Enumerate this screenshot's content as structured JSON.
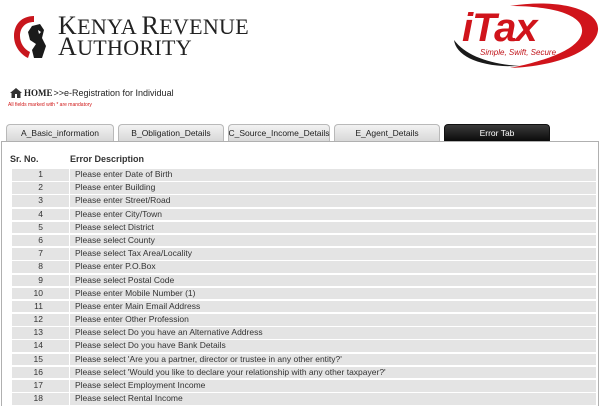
{
  "header": {
    "org_line1_big": "K",
    "org_line1_rest": "ENYA ",
    "org_line1_big2": "R",
    "org_line1_rest2": "EVENUE",
    "org_line2_big": "A",
    "org_line2_rest": "UTHORITY",
    "itax_word": "iTax",
    "itax_tagline": "Simple, Swift, Secure"
  },
  "breadcrumb": {
    "home": "HOME",
    "path": ">>e-Registration for Individual"
  },
  "mandatory_note": "All fields marked with * are mandatory",
  "tabs": [
    {
      "label": "A_Basic_information"
    },
    {
      "label": "B_Obligation_Details"
    },
    {
      "label": "C_Source_Income_Details"
    },
    {
      "label": "E_Agent_Details"
    },
    {
      "label": "Error Tab"
    }
  ],
  "table": {
    "col_sr": "Sr. No.",
    "col_desc": "Error Description",
    "rows": [
      {
        "no": "1",
        "desc": "Please enter Date of Birth"
      },
      {
        "no": "2",
        "desc": "Please enter Building"
      },
      {
        "no": "3",
        "desc": "Please enter Street/Road"
      },
      {
        "no": "4",
        "desc": "Please enter City/Town"
      },
      {
        "no": "5",
        "desc": "Please select District"
      },
      {
        "no": "6",
        "desc": "Please select County"
      },
      {
        "no": "7",
        "desc": "Please select Tax Area/Locality"
      },
      {
        "no": "8",
        "desc": "Please enter P.O.Box"
      },
      {
        "no": "9",
        "desc": "Please select Postal Code"
      },
      {
        "no": "10",
        "desc": "Please enter Mobile Number (1)"
      },
      {
        "no": "11",
        "desc": "Please enter Main Email Address"
      },
      {
        "no": "12",
        "desc": "Please enter Other Profession"
      },
      {
        "no": "13",
        "desc": "Please select Do you have an Alternative Address"
      },
      {
        "no": "14",
        "desc": "Please select Do you have Bank Details"
      },
      {
        "no": "15",
        "desc": "Please select 'Are you a partner, director or trustee in any other entity?'"
      },
      {
        "no": "16",
        "desc": "Please select 'Would you like to declare your relationship with any other taxpayer?'"
      },
      {
        "no": "17",
        "desc": "Please select Employment Income"
      },
      {
        "no": "18",
        "desc": "Please select Rental Income"
      }
    ]
  }
}
